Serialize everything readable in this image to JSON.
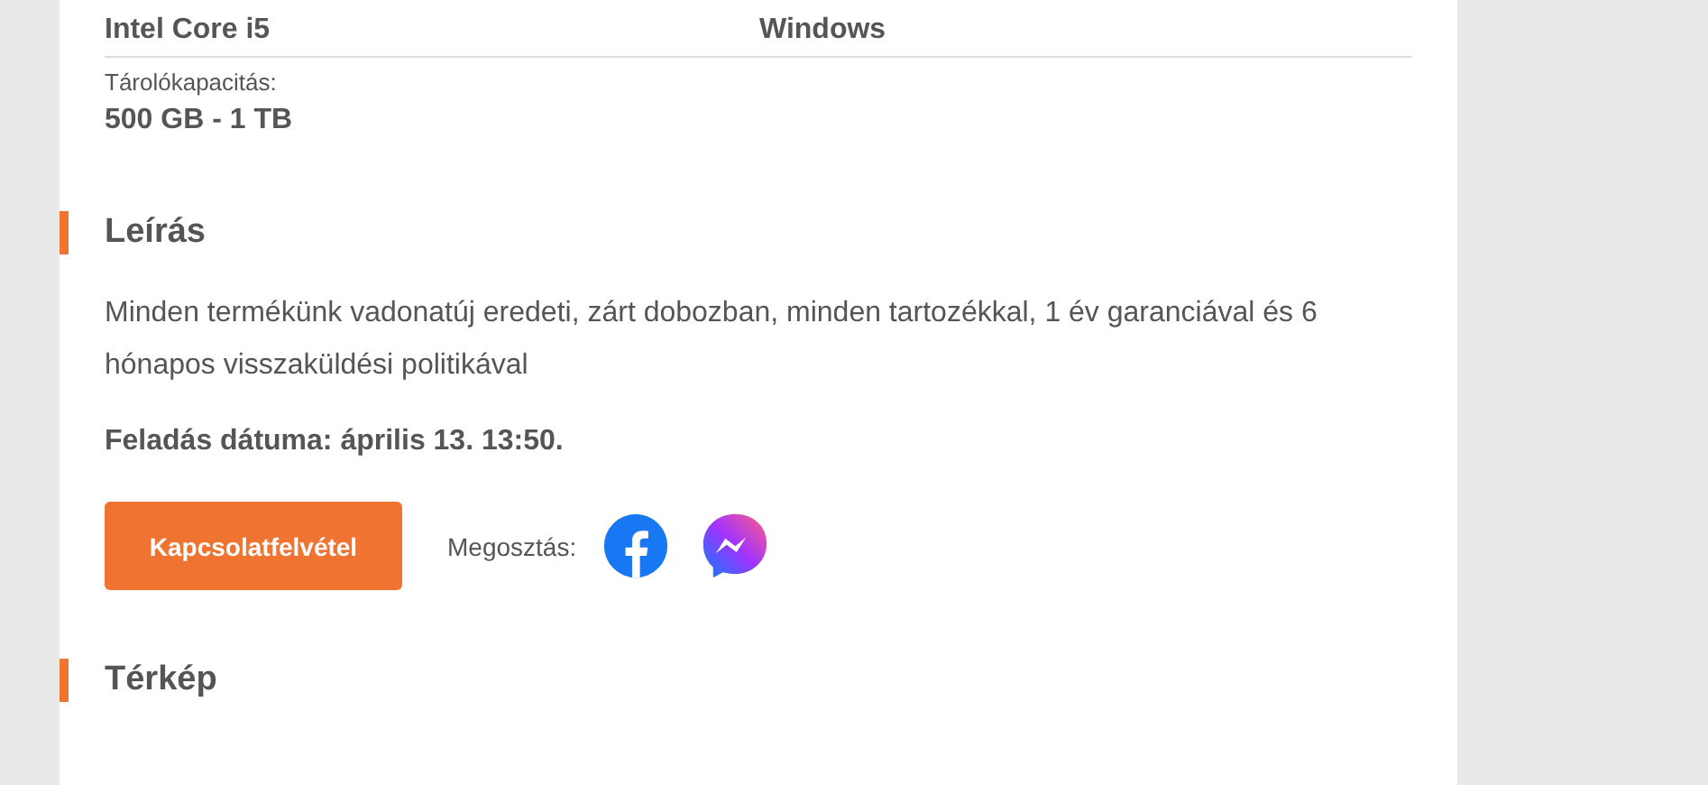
{
  "specs": [
    {
      "value": "Intel Core i5"
    },
    {
      "value": "Windows"
    }
  ],
  "storage": {
    "label": "Tárolókapacitás:",
    "value": "500 GB - 1 TB"
  },
  "description": {
    "heading": "Leírás",
    "text": "Minden termékünk vadonatúj eredeti, zárt dobozban, minden tartozékkal, 1 év garanciával és 6 hónapos visszaküldési politikával",
    "posted": "Feladás dátuma: április 13. 13:50."
  },
  "contact_button": "Kapcsolatfelvétel",
  "share": {
    "label": "Megosztás:",
    "icons": [
      {
        "kind": "facebook"
      },
      {
        "kind": "messenger"
      }
    ]
  },
  "map": {
    "heading": "Térkép"
  }
}
